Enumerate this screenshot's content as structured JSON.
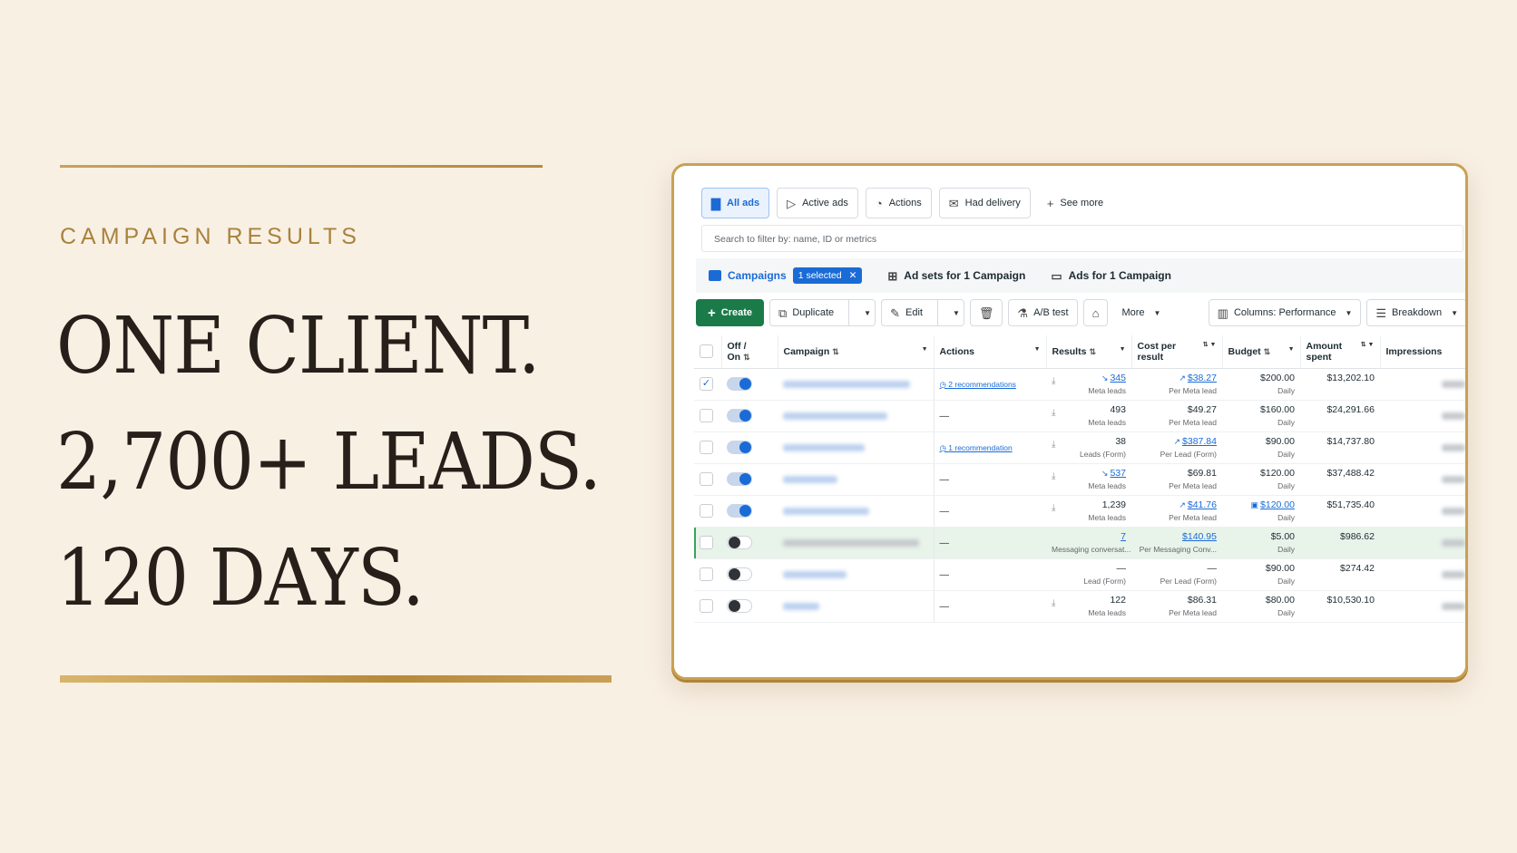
{
  "hero": {
    "eyebrow": "CAMPAIGN RESULTS",
    "lines": [
      "ONE CLIENT.",
      "2,700+ LEADS.",
      "120 DAYS."
    ]
  },
  "colors": {
    "gold": "#b88a3c",
    "ink": "#27201a",
    "background": "#f9f0e4",
    "meta_blue": "#1a6bd6",
    "create_green": "#1a7b49"
  },
  "filters": {
    "all_ads": "All ads",
    "active_ads": "Active ads",
    "actions": "Actions",
    "had_delivery": "Had delivery",
    "see_more": "See more"
  },
  "search": {
    "placeholder": "Search to filter by: name, ID or metrics"
  },
  "levels": {
    "campaigns": "Campaigns",
    "selected": "1 selected",
    "ad_sets": "Ad sets for 1 Campaign",
    "ads": "Ads for 1 Campaign"
  },
  "toolbar": {
    "create": "Create",
    "duplicate": "Duplicate",
    "edit": "Edit",
    "ab_test": "A/B test",
    "more": "More",
    "columns": "Columns: Performance",
    "breakdown": "Breakdown"
  },
  "table": {
    "headers": {
      "off_on": "Off / On",
      "campaign": "Campaign",
      "actions": "Actions",
      "results": "Results",
      "cost_per_result": "Cost per result",
      "budget": "Budget",
      "amount_spent": "Amount spent",
      "impressions": "Impressions"
    },
    "rows": [
      {
        "checked": true,
        "on": true,
        "action": "2 recommendations",
        "result": "345",
        "result_type": "Meta leads",
        "cost": "$38.27",
        "cost_type": "Per Meta lead",
        "budget": "$200.00",
        "budget_type": "Daily",
        "spent": "$13,202.10"
      },
      {
        "checked": false,
        "on": true,
        "action": "—",
        "result": "493",
        "result_type": "Meta leads",
        "cost": "$49.27",
        "cost_type": "Per Meta lead",
        "budget": "$160.00",
        "budget_type": "Daily",
        "spent": "$24,291.66"
      },
      {
        "checked": false,
        "on": true,
        "action": "1 recommendation",
        "result": "38",
        "result_type": "Leads (Form)",
        "cost": "$387.84",
        "cost_type": "Per Lead (Form)",
        "budget": "$90.00",
        "budget_type": "Daily",
        "spent": "$14,737.80"
      },
      {
        "checked": false,
        "on": true,
        "action": "—",
        "result": "537",
        "result_type": "Meta leads",
        "cost": "$69.81",
        "cost_type": "Per Meta lead",
        "budget": "$120.00",
        "budget_type": "Daily",
        "spent": "$37,488.42"
      },
      {
        "checked": false,
        "on": true,
        "action": "—",
        "result": "1,239",
        "result_type": "Meta leads",
        "cost": "$41.76",
        "cost_type": "Per Meta lead",
        "budget": "$120.00",
        "budget_type": "Daily",
        "spent": "$51,735.40"
      },
      {
        "checked": false,
        "on": false,
        "action": "—",
        "result": "7",
        "result_type": "Messaging conversat...",
        "cost": "$140.95",
        "cost_type": "Per Messaging Conv...",
        "budget": "$5.00",
        "budget_type": "Daily",
        "spent": "$986.62"
      },
      {
        "checked": false,
        "on": false,
        "action": "—",
        "result": "—",
        "result_type": "Lead (Form)",
        "cost": "—",
        "cost_type": "Per Lead (Form)",
        "budget": "$90.00",
        "budget_type": "Daily",
        "spent": "$274.42"
      },
      {
        "checked": false,
        "on": false,
        "action": "—",
        "result": "122",
        "result_type": "Meta leads",
        "cost": "$86.31",
        "cost_type": "Per Meta lead",
        "budget": "$80.00",
        "budget_type": "Daily",
        "spent": "$10,530.10"
      }
    ]
  }
}
